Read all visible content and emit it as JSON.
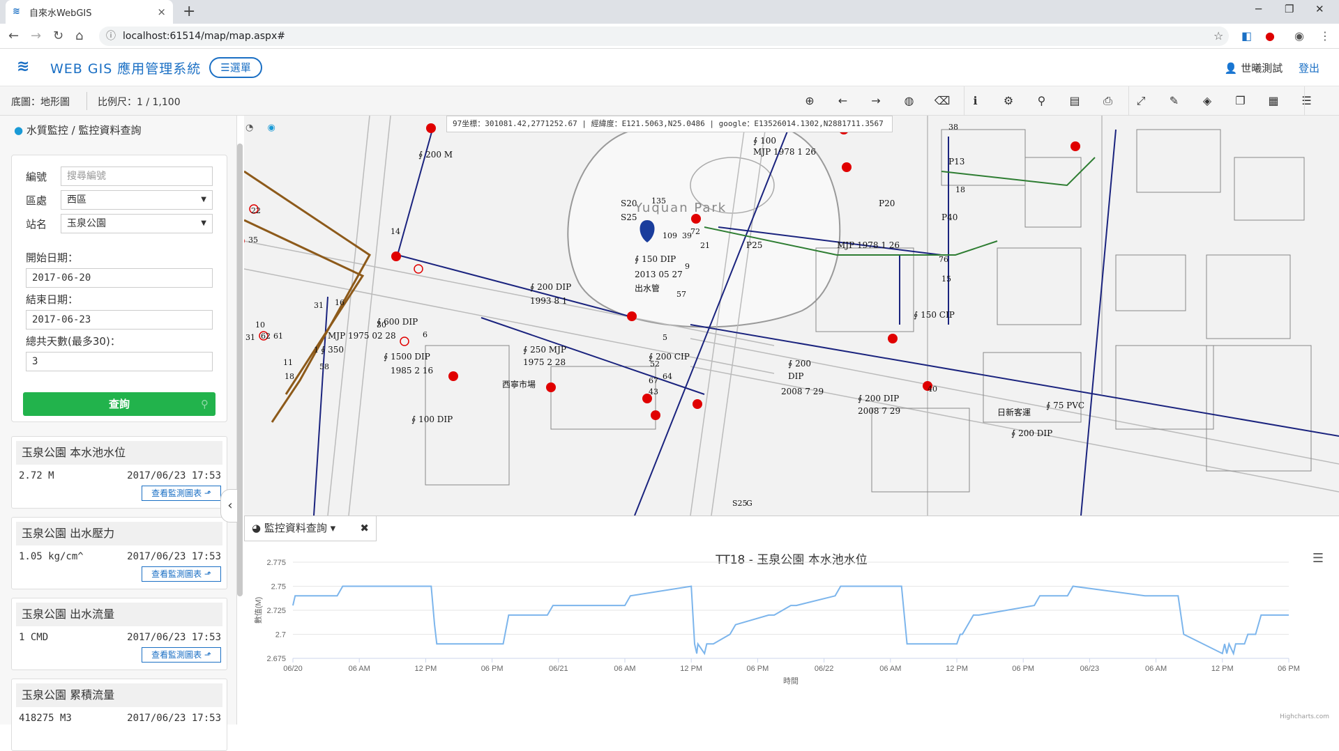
{
  "browser": {
    "tab_title": "自來水WebGIS",
    "tab_close": "×",
    "new_tab": "+",
    "url_icon": "ⓘ",
    "url": "localhost:61514/map/map.aspx#",
    "controls": {
      "minimize": "─",
      "maximize": "❐",
      "close": "✕"
    }
  },
  "app": {
    "logo_glyph": "𝒲",
    "title": "WEB GIS 應用管理系統",
    "menu_label": "☰選單",
    "user_name": "世曦測試",
    "logout_label": "登出",
    "accent_color": "#1a6fc4"
  },
  "toolbar": {
    "basemap_label": "底圖：地形圖",
    "scale_label": "比例尺：1 / 1,100",
    "tools": [
      {
        "name": "zoom-in-icon",
        "glyph": "⊕"
      },
      {
        "name": "back-icon",
        "glyph": "←"
      },
      {
        "name": "forward-icon",
        "glyph": "→"
      },
      {
        "name": "globe-icon",
        "glyph": "◍"
      },
      {
        "name": "eraser-icon",
        "glyph": "⌫"
      },
      {
        "name": "info-icon",
        "glyph": "ℹ"
      },
      {
        "name": "settings-icon",
        "glyph": "⚙"
      },
      {
        "name": "location-icon",
        "glyph": "⚲"
      },
      {
        "name": "save-icon",
        "glyph": "▤"
      },
      {
        "name": "print-icon",
        "glyph": "⎙"
      },
      {
        "name": "fullscreen-icon",
        "glyph": "⤢"
      },
      {
        "name": "brush-icon",
        "glyph": "✎"
      },
      {
        "name": "layers-icon",
        "glyph": "◈"
      },
      {
        "name": "copy-icon",
        "glyph": "❐"
      },
      {
        "name": "map-icon",
        "glyph": "▦"
      },
      {
        "name": "list-icon",
        "glyph": "☰"
      }
    ]
  },
  "sidebar": {
    "breadcrumb_icon": "💧",
    "breadcrumb": "水質監控 / 監控資料查詢",
    "form": {
      "id_label": "編號",
      "id_placeholder": "搜尋編號",
      "district_label": "區處",
      "district_value": "西區",
      "station_label": "站名",
      "station_value": "玉泉公園",
      "start_label": "開始日期：",
      "start_value": "2017-06-20",
      "end_label": "結束日期：",
      "end_value": "2017-06-23",
      "days_label": "總共天數(最多30)：",
      "days_value": "3",
      "query_label": "查詢",
      "caret": "▼"
    },
    "cards": [
      {
        "title": "玉泉公園 本水池水位",
        "value": "2.72 M",
        "time": "2017/06/23 17:53",
        "button": "查看監測圖表 ⬏"
      },
      {
        "title": "玉泉公園 出水壓力",
        "value": "1.05 kg/cm^",
        "time": "2017/06/23 17:53",
        "button": "查看監測圖表 ⬏"
      },
      {
        "title": "玉泉公園 出水流量",
        "value": "1 CMD",
        "time": "2017/06/23 17:53",
        "button": "查看監測圖表 ⬏"
      },
      {
        "title": "玉泉公園 累積流量",
        "value": "418275 M3",
        "time": "2017/06/23 17:53",
        "button": ""
      }
    ]
  },
  "map": {
    "coord_text": "97坐標：301081.42,2771252.67 | 經緯度：E121.5063,N25.0486 | google：E13526014.1302,N2881711.3567",
    "park_label": "Yuquan Park",
    "labels": [
      "∮ 200 M",
      "∮ 200 DIP",
      "1993 8 1",
      "∮ 600 DIP",
      "∮ 350",
      "MJP 1975 02 28",
      "∮ 250 MJP",
      "1975 2 28",
      "∮ 1500 DIP",
      "1985 2 16",
      "∮ 200 CIP",
      "∮ 150 DIP",
      "2013 05 27",
      "出水管",
      "∮ 200",
      "DIP",
      "2008 7 29",
      "∮ 200 DIP",
      "2008 7 29",
      "∮ 100",
      "MJP 1978 1 26",
      "∮ 150 CIP",
      "P25",
      "P20",
      "P40",
      "P13",
      "S20",
      "S25",
      "MJP 1978 1 26",
      "∮ 100 DIP",
      "西寧市場",
      "日新客運",
      "∮ 75 PVC",
      "∮ 200 DIP",
      "22",
      "35",
      "14",
      "10",
      "31",
      "62",
      "61",
      "11",
      "18",
      "58",
      "1",
      "16",
      "30",
      "6",
      "135",
      "109",
      "39",
      "72",
      "21",
      "9",
      "57",
      "5",
      "52",
      "67",
      "43",
      "64",
      "34",
      "38",
      "18",
      "76",
      "40",
      "15",
      "31",
      "S25",
      "G"
    ]
  },
  "chart_panel": {
    "tab_icon": "◕",
    "tab_label": "監控資料查詢 ▾",
    "tab_close": "✖",
    "menu_glyph": "☰",
    "credits": "Highcharts.com"
  },
  "chart_data": {
    "type": "line",
    "title": "TT18 - 玉泉公園 本水池水位",
    "xlabel": "時間",
    "ylabel": "數值(M)",
    "ylim": [
      2.675,
      2.775
    ],
    "yticks": [
      2.675,
      2.7,
      2.725,
      2.75,
      2.775
    ],
    "xticks": [
      "06/20",
      "06 AM",
      "12 PM",
      "06 PM",
      "06/21",
      "06 AM",
      "12 PM",
      "06 PM",
      "06/22",
      "06 AM",
      "12 PM",
      "06 PM",
      "06/23",
      "06 AM",
      "12 PM",
      "06 PM"
    ],
    "xlim_hours": [
      0,
      90
    ],
    "line_color": "#7cb5ec",
    "series": [
      {
        "x": [
          0,
          0.2,
          4,
          4.5,
          12.5,
          12.8,
          13,
          13.2,
          19,
          19.5,
          23,
          23.5,
          30,
          30.5,
          36,
          36.3,
          36.5,
          36.6,
          37.2,
          37.4,
          38,
          39.5,
          40,
          43,
          43.5,
          45,
          45.5,
          49,
          49.5,
          55,
          55.5,
          60,
          60.3,
          60.5,
          61.5,
          62,
          67,
          67.5,
          70,
          70.5,
          77,
          77.5,
          80,
          80.5,
          84,
          84.2,
          84.4,
          84.6,
          85,
          85.2,
          86,
          86.3,
          87,
          87.5,
          89,
          90
        ],
        "y": [
          2.73,
          2.74,
          2.74,
          2.75,
          2.75,
          2.71,
          2.69,
          2.69,
          2.69,
          2.72,
          2.72,
          2.73,
          2.73,
          2.74,
          2.75,
          2.69,
          2.68,
          2.69,
          2.68,
          2.69,
          2.69,
          2.7,
          2.71,
          2.72,
          2.72,
          2.73,
          2.73,
          2.74,
          2.75,
          2.75,
          2.69,
          2.69,
          2.7,
          2.7,
          2.72,
          2.72,
          2.73,
          2.74,
          2.74,
          2.75,
          2.74,
          2.74,
          2.74,
          2.7,
          2.68,
          2.69,
          2.68,
          2.69,
          2.68,
          2.69,
          2.69,
          2.7,
          2.7,
          2.72,
          2.72,
          2.72
        ]
      }
    ]
  }
}
